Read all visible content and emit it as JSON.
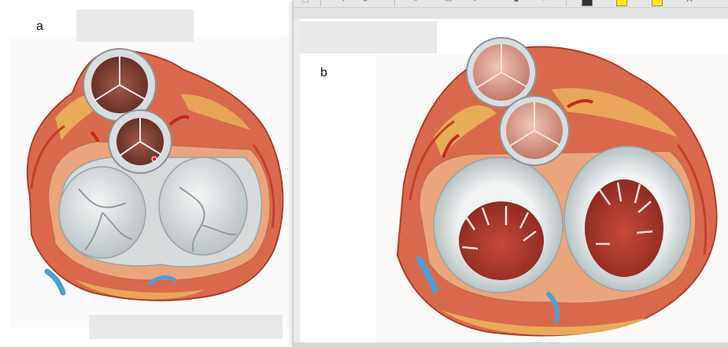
{
  "panels": {
    "a": {
      "label": "a"
    },
    "b": {
      "label": "b"
    }
  },
  "toolbar": {
    "icons": [
      "select-icon",
      "back-icon",
      "rotate-icon",
      "lasso-icon",
      "rectangle-icon",
      "pen-icon",
      "stamp-icon",
      "crop-icon",
      "line-color-icon",
      "fill-color-icon",
      "highlight-color-icon",
      "text-style-icon"
    ]
  },
  "colors": {
    "myocardium": "#d9694d",
    "muscle_light": "#eba57c",
    "fat": "#eab35a",
    "valve_leaflet": "#e3e6e6",
    "valve_shadow": "#aab4b6",
    "aortic_cusp": "#9a5242",
    "pulmonary_cusp": "#d89a8a",
    "chamber_red": "#b43a2c",
    "vessel_blue": "#4f9ed1",
    "redaction": "#e9e9e9",
    "window_gray": "#ececec"
  }
}
